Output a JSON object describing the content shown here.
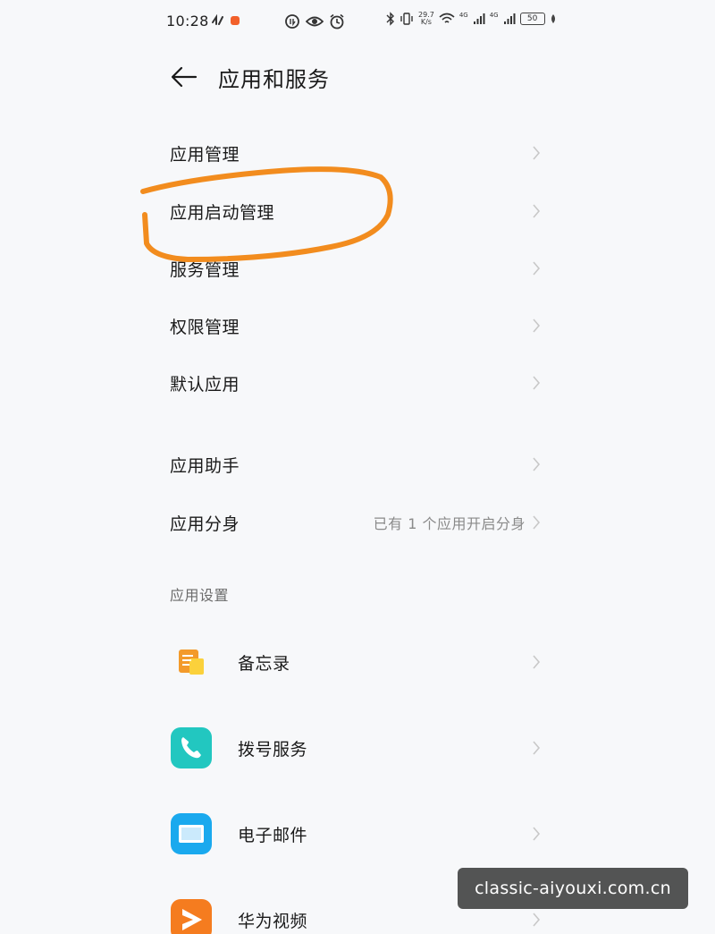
{
  "status_bar": {
    "time": "10:28",
    "net_speed_value": "29.7",
    "net_speed_unit": "K/s",
    "sig1": "4G",
    "sig2": "4G",
    "battery": "50"
  },
  "header": {
    "title": "应用和服务",
    "back_icon": "arrow-left-icon"
  },
  "menu_group_1": [
    {
      "label": "应用管理"
    },
    {
      "label": "应用启动管理"
    },
    {
      "label": "服务管理"
    },
    {
      "label": "权限管理"
    },
    {
      "label": "默认应用"
    }
  ],
  "menu_group_2": [
    {
      "label": "应用助手",
      "value": ""
    },
    {
      "label": "应用分身",
      "value": "已有 1 个应用开启分身"
    }
  ],
  "app_settings": {
    "section_title": "应用设置",
    "apps": [
      {
        "label": "备忘录",
        "icon": "notepad-icon",
        "color": "#f39a2b"
      },
      {
        "label": "拨号服务",
        "icon": "phone-icon",
        "color": "#22c7c0"
      },
      {
        "label": "电子邮件",
        "icon": "email-icon",
        "color": "#1aa9ee"
      },
      {
        "label": "华为视频",
        "icon": "video-icon",
        "color": "#f57c1f"
      }
    ]
  },
  "annotation": {
    "color": "#f28c1e"
  },
  "watermark": {
    "text": "classic-aiyouxi.com.cn"
  },
  "colors": {
    "background": "#f7f8fa",
    "text_primary": "#1a1a1a",
    "text_secondary": "#8a8a8a",
    "chevron": "#c8c8c8"
  }
}
